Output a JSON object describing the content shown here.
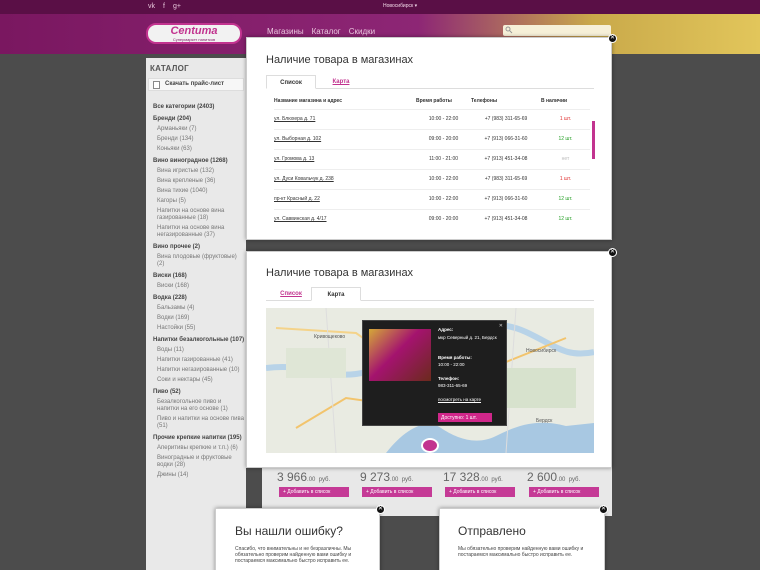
{
  "header": {
    "social": [
      "vk",
      "f",
      "g+"
    ],
    "city": "Новосибирск ▾",
    "logo": "Centuma",
    "logo_sub": "Супермаркет напитков",
    "nav": [
      "Магазины",
      "Каталог",
      "Скидки"
    ],
    "search_icon": "search-icon"
  },
  "sidebar": {
    "title": "КАТАЛОГ",
    "price_list": "Скачать прайс-лист",
    "categories": [
      {
        "label": "Все категории (2403)",
        "level": "top"
      },
      {
        "label": "Бренди (204)",
        "level": "top"
      },
      {
        "label": "Арманьяки (7)",
        "level": "sub"
      },
      {
        "label": "Бренди (134)",
        "level": "sub"
      },
      {
        "label": "Коньяки (63)",
        "level": "sub"
      },
      {
        "label": "Вино виноградное (1268)",
        "level": "top"
      },
      {
        "label": "Вина игристые (132)",
        "level": "sub"
      },
      {
        "label": "Вина крепленые (36)",
        "level": "sub"
      },
      {
        "label": "Вина тихие (1040)",
        "level": "sub"
      },
      {
        "label": "Кагоры (5)",
        "level": "sub"
      },
      {
        "label": "Напитки на основе вина газированные (18)",
        "level": "sub"
      },
      {
        "label": "Напитки на основе вина негазированные (37)",
        "level": "sub"
      },
      {
        "label": "Вино прочее (2)",
        "level": "top"
      },
      {
        "label": "Вина плодовые (фруктовые) (2)",
        "level": "sub"
      },
      {
        "label": "Виски (168)",
        "level": "top"
      },
      {
        "label": "Виски (168)",
        "level": "sub"
      },
      {
        "label": "Водка (228)",
        "level": "top"
      },
      {
        "label": "Бальзамы (4)",
        "level": "sub"
      },
      {
        "label": "Водки (169)",
        "level": "sub"
      },
      {
        "label": "Настойки (55)",
        "level": "sub"
      },
      {
        "label": "Напитки безалкогольные (107)",
        "level": "top"
      },
      {
        "label": "Воды (11)",
        "level": "sub"
      },
      {
        "label": "Напитки газированные (41)",
        "level": "sub"
      },
      {
        "label": "Напитки негазированные (10)",
        "level": "sub"
      },
      {
        "label": "Соки и нектары (45)",
        "level": "sub"
      },
      {
        "label": "Пиво (52)",
        "level": "top"
      },
      {
        "label": "Безалкогольное пиво и напитки на его основе (1)",
        "level": "sub"
      },
      {
        "label": "Пиво и напитки на основе пива (51)",
        "level": "sub"
      },
      {
        "label": "Прочие крепкие напитки (195)",
        "level": "top"
      },
      {
        "label": "Аперитивы крепкие и т.п.) (6)",
        "level": "sub"
      },
      {
        "label": "Виноградные и фруктовые водки (28)",
        "level": "sub"
      },
      {
        "label": "Джины (14)",
        "level": "sub"
      }
    ]
  },
  "products": [
    {
      "price": "3 966",
      "cents": ".00",
      "cur": "руб.",
      "btn": "+ Добавить в список"
    },
    {
      "price": "9 273",
      "cents": ".00",
      "cur": "руб.",
      "btn": "+ Добавить в список"
    },
    {
      "price": "17 328",
      "cents": ".00",
      "cur": "руб.",
      "btn": "+ Добавить в список"
    },
    {
      "price": "2 600",
      "cents": ".00",
      "cur": "руб.",
      "btn": "+ Добавить в список"
    }
  ],
  "modal_list": {
    "title": "Наличие товара в магазинах",
    "tab_list": "Список",
    "tab_map": "Карта",
    "columns": [
      "Название магазина и адрес",
      "Время работы",
      "Телефоны",
      "В наличии"
    ],
    "rows": [
      {
        "addr": "ул. Блюхера д. 71",
        "hours": "10:00 - 22:00",
        "phone": "+7 (983) 311-65-69",
        "stock": "1 шт.",
        "status": "red"
      },
      {
        "addr": "ул. Выборная д. 102",
        "hours": "09:00 - 20:00",
        "phone": "+7 (913) 066-31-60",
        "stock": "12 шт.",
        "status": "green"
      },
      {
        "addr": "ул. Громова д. 13",
        "hours": "11:00 - 21:00",
        "phone": "+7 (913) 451-34-08",
        "stock": "нет",
        "status": "grey"
      },
      {
        "addr": "ул. Дуси Ковальчук д. 238",
        "hours": "10:00 - 22:00",
        "phone": "+7 (983) 311-65-69",
        "stock": "1 шт.",
        "status": "red"
      },
      {
        "addr": "пр-кт Красный д. 22",
        "hours": "10:00 - 22:00",
        "phone": "+7 (913) 066-31-60",
        "stock": "12 шт.",
        "status": "green"
      },
      {
        "addr": "ул. Саввинская д. 4/17",
        "hours": "09:00 - 20:00",
        "phone": "+7 (913) 451-34-08",
        "stock": "12 шт.",
        "status": "green"
      }
    ]
  },
  "modal_map": {
    "title": "Наличие товара в магазинах",
    "tab_list": "Список",
    "tab_map": "Карта",
    "map_labels": [
      "Кривощеково",
      "Новосибирск",
      "Бердск"
    ],
    "popup": {
      "addr_label": "Адрес:",
      "addr": "мкр Северный д. 21, Бердск",
      "hours_label": "Время работы:",
      "hours": "10:00 - 22:00",
      "phone_label": "Телефон:",
      "phone": "983-311-65-69",
      "link": "посмотреть на карте",
      "avail": "Доступно: 1 шт."
    }
  },
  "dialog_error": {
    "title": "Вы нашли ошибку?",
    "text": "Спасибо, что внимательны и не безразличны. Мы обязательно проверим найденную вами ошибку и постараемся максимально быстро исправить ее."
  },
  "dialog_sent": {
    "title": "Отправлено",
    "text": "Мы обязательно проверим найденную вами ошибку и постараемся максимально быстро исправить ее."
  }
}
